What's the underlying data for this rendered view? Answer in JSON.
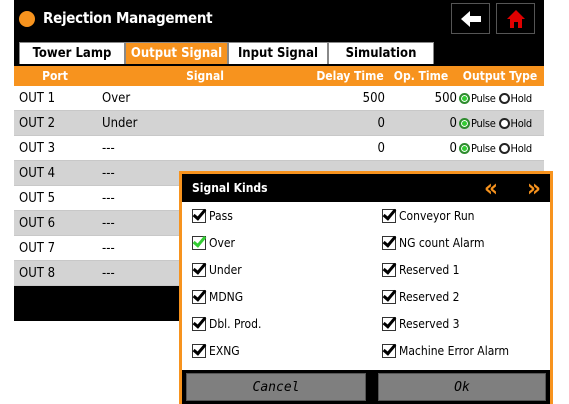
{
  "window": {
    "title": "Rejection Management",
    "accent": "#f7931e"
  },
  "toolbar": {
    "back_icon": "arrow-left-icon",
    "home_icon": "home-icon",
    "home_color": "#e00000"
  },
  "tabs": [
    {
      "label": "Tower Lamp",
      "active": false
    },
    {
      "label": "Output Signal",
      "active": true
    },
    {
      "label": "Input Signal",
      "active": false
    },
    {
      "label": "Simulation",
      "active": false
    }
  ],
  "grid": {
    "headers": {
      "port": "Port",
      "signal": "Signal",
      "delay": "Delay Time",
      "op": "Op. Time",
      "output": "Output Type"
    },
    "output_labels": {
      "pulse": "Pulse",
      "hold": "Hold"
    },
    "rows": [
      {
        "port": "OUT 1",
        "signal": "Over",
        "delay": "500",
        "op": "500",
        "type": "pulse"
      },
      {
        "port": "OUT 2",
        "signal": "Under",
        "delay": "0",
        "op": "0",
        "type": "pulse"
      },
      {
        "port": "OUT 3",
        "signal": "---",
        "delay": "0",
        "op": "0",
        "type": "pulse"
      },
      {
        "port": "OUT 4",
        "signal": "---"
      },
      {
        "port": "OUT 5",
        "signal": "---"
      },
      {
        "port": "OUT 6",
        "signal": "---"
      },
      {
        "port": "OUT 7",
        "signal": "---"
      },
      {
        "port": "OUT 8",
        "signal": "---"
      }
    ]
  },
  "dialog": {
    "title": "Signal Kinds",
    "prev_icon": "double-chevron-left-icon",
    "next_icon": "double-chevron-right-icon",
    "options": [
      {
        "label": "Pass",
        "checked": true
      },
      {
        "label": "Conveyor Run",
        "checked": true
      },
      {
        "label": "Over",
        "checked": true,
        "highlight": "#33cc33"
      },
      {
        "label": "NG count Alarm",
        "checked": true
      },
      {
        "label": "Under",
        "checked": true
      },
      {
        "label": "Reserved 1",
        "checked": true
      },
      {
        "label": "MDNG",
        "checked": true
      },
      {
        "label": "Reserved 2",
        "checked": true
      },
      {
        "label": "Dbl. Prod.",
        "checked": true
      },
      {
        "label": "Reserved 3",
        "checked": true
      },
      {
        "label": "EXNG",
        "checked": true
      },
      {
        "label": "Machine Error Alarm",
        "checked": true
      }
    ],
    "cancel_label": "Cancel",
    "ok_label": "Ok"
  }
}
